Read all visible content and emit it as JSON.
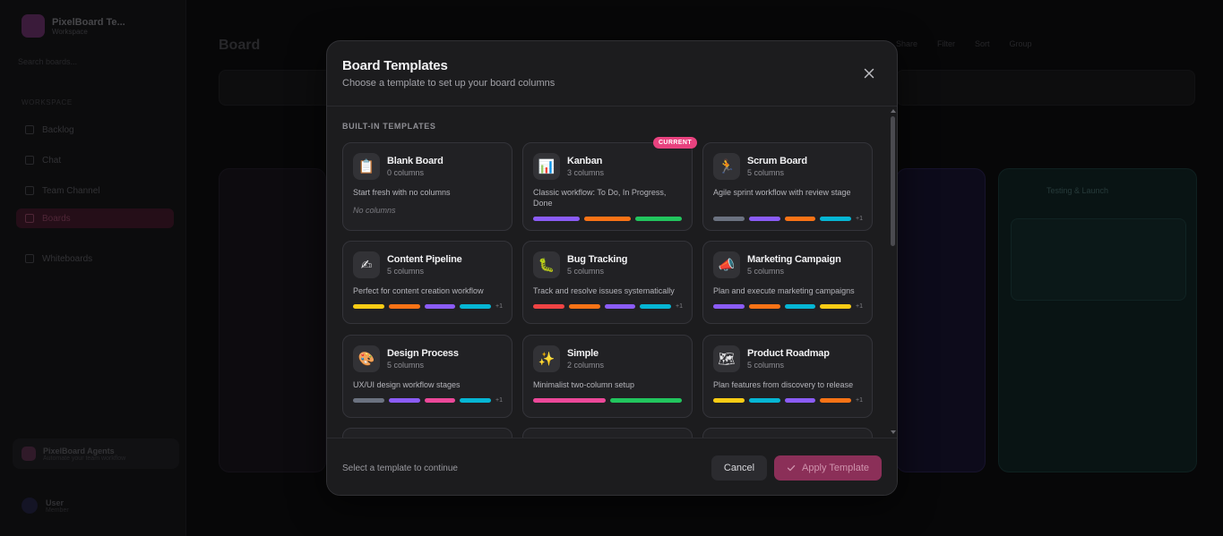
{
  "background": {
    "workspace_name": "PixelBoard Te...",
    "workspace_sub": "Workspace",
    "search_placeholder": "Search boards...",
    "nav_label": "WORKSPACE",
    "nav_items": [
      "Backlog",
      "Chat",
      "Team Channel",
      "Boards",
      "Whiteboards"
    ],
    "promo_title": "PixelBoard Agents",
    "promo_sub": "Automate your team workflow",
    "user_name": "User",
    "user_sub": "Member",
    "page_title": "Board",
    "top_actions": [
      "Share",
      "Filter",
      "Sort",
      "Group"
    ],
    "column_title": "Testing & Launch"
  },
  "modal": {
    "title": "Board Templates",
    "subtitle": "Choose a template to set up your board columns",
    "close_icon": "close-icon",
    "section_label": "BUILT-IN TEMPLATES",
    "current_badge": "CURRENT",
    "templates": [
      {
        "icon": "📋",
        "icon_name": "clipboard-icon",
        "name": "Blank Board",
        "columns": "0 columns",
        "description": "Start fresh with no columns",
        "empty_text": "No columns",
        "bars": [],
        "more": ""
      },
      {
        "icon": "📊",
        "icon_name": "bar-chart-icon",
        "name": "Kanban",
        "columns": "3 columns",
        "description": "Classic workflow: To Do, In Progress, Done",
        "bars": [
          "#8b5cf6",
          "#f97316",
          "#22c55e"
        ],
        "more": "",
        "current": true
      },
      {
        "icon": "🏃",
        "icon_name": "runner-icon",
        "name": "Scrum Board",
        "columns": "5 columns",
        "description": "Agile sprint workflow with review stage",
        "bars": [
          "#6b7280",
          "#8b5cf6",
          "#f97316",
          "#06b6d4"
        ],
        "more": "+1"
      },
      {
        "icon": "✍",
        "icon_name": "writing-hand-icon",
        "name": "Content Pipeline",
        "columns": "5 columns",
        "description": "Perfect for content creation workflow",
        "bars": [
          "#facc15",
          "#f97316",
          "#8b5cf6",
          "#06b6d4"
        ],
        "more": "+1"
      },
      {
        "icon": "🐛",
        "icon_name": "bug-icon",
        "name": "Bug Tracking",
        "columns": "5 columns",
        "description": "Track and resolve issues systematically",
        "bars": [
          "#ef4444",
          "#f97316",
          "#8b5cf6",
          "#06b6d4"
        ],
        "more": "+1"
      },
      {
        "icon": "📣",
        "icon_name": "megaphone-icon",
        "name": "Marketing Campaign",
        "columns": "5 columns",
        "description": "Plan and execute marketing campaigns",
        "bars": [
          "#8b5cf6",
          "#f97316",
          "#06b6d4",
          "#facc15"
        ],
        "more": "+1"
      },
      {
        "icon": "🎨",
        "icon_name": "palette-icon",
        "name": "Design Process",
        "columns": "5 columns",
        "description": "UX/UI design workflow stages",
        "bars": [
          "#6b7280",
          "#8b5cf6",
          "#ec4899",
          "#06b6d4"
        ],
        "more": "+1"
      },
      {
        "icon": "✨",
        "icon_name": "sparkles-icon",
        "name": "Simple",
        "columns": "2 columns",
        "description": "Minimalist two-column setup",
        "bars": [
          "#ec4899",
          "#22c55e"
        ],
        "more": ""
      },
      {
        "icon": "🗺",
        "icon_name": "map-icon",
        "name": "Product Roadmap",
        "columns": "5 columns",
        "description": "Plan features from discovery to release",
        "bars": [
          "#facc15",
          "#06b6d4",
          "#8b5cf6",
          "#f97316"
        ],
        "more": "+1"
      }
    ],
    "footer": {
      "hint": "Select a template to continue",
      "cancel_label": "Cancel",
      "apply_label": "Apply Template",
      "apply_icon": "check-icon"
    }
  }
}
